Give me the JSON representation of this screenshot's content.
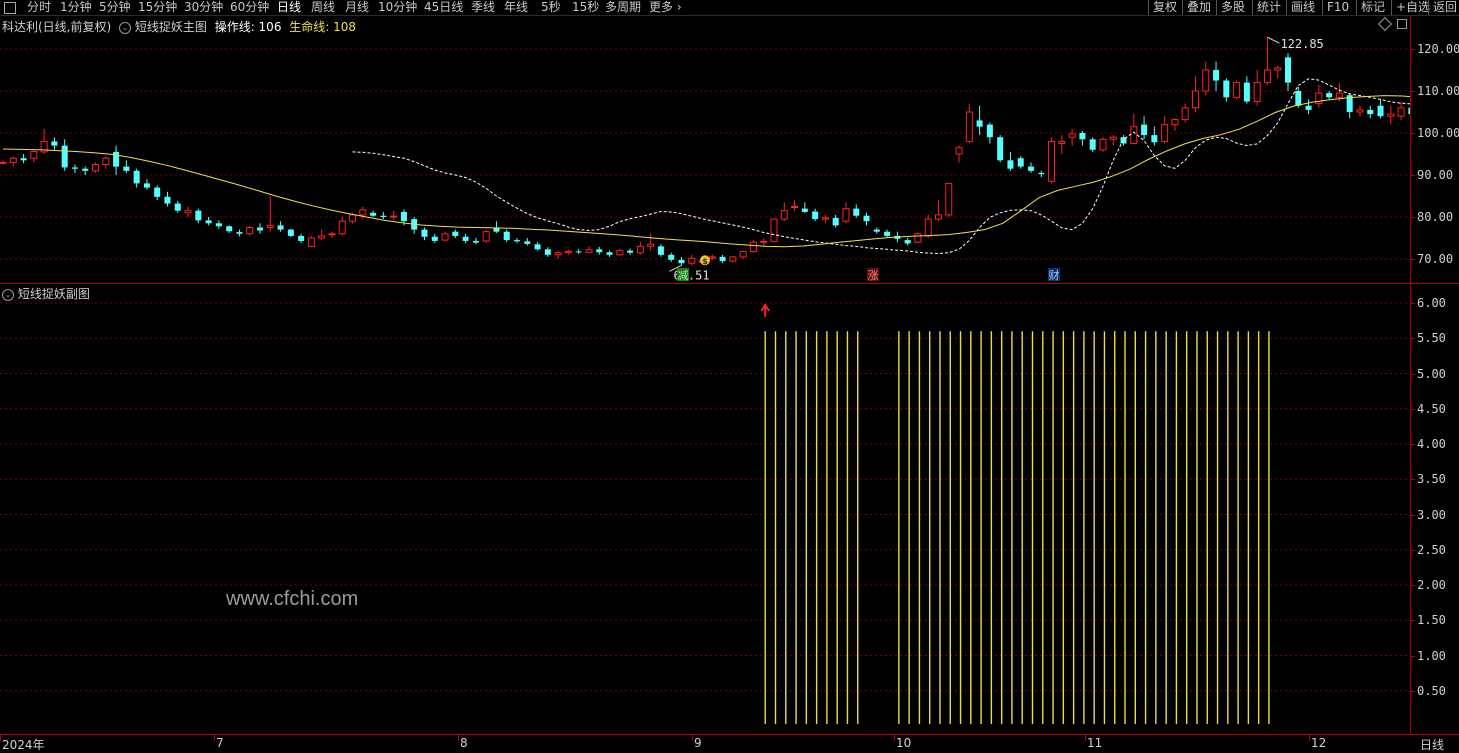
{
  "toolbar": {
    "periods": [
      "分时",
      "1分钟",
      "5分钟",
      "15分钟",
      "30分钟",
      "60分钟",
      "日线",
      "周线",
      "月线",
      "10分钟",
      "45日线",
      "季线",
      "年线",
      "5秒",
      "15秒",
      "多周期",
      "更多"
    ],
    "active_period": "日线",
    "right_buttons": [
      "复权",
      "叠加",
      "多股",
      "统计",
      "画线",
      "F10",
      "标记",
      "+自选",
      "返回"
    ]
  },
  "main": {
    "stock_title": "科达利(日线,前复权)",
    "indicator_name": "短线捉妖主图",
    "op_line_label": "操作线: 106",
    "life_line_label": "生命线: 108",
    "high_label": "122.85",
    "low_label": "68.51",
    "markers": [
      "减",
      "涨",
      "财"
    ],
    "buy_marker": "$"
  },
  "sub": {
    "indicator_name": "短线捉妖副图",
    "signal_value": 5.6
  },
  "y_axis_main": [
    "120.00",
    "110.00",
    "100.00",
    "90.00",
    "80.00",
    "70.00"
  ],
  "y_axis_sub": [
    "6.00",
    "5.50",
    "5.00",
    "4.50",
    "4.00",
    "3.50",
    "3.00",
    "2.50",
    "2.00",
    "1.50",
    "1.00",
    "0.50"
  ],
  "x_axis": [
    "2024年",
    "7",
    "8",
    "9",
    "10",
    "11",
    "12"
  ],
  "period_label": "日线",
  "watermark": "www.cfchi.com",
  "colors": {
    "up": "#ff2020",
    "down": "#54ffff",
    "ma_white": "#ffffff",
    "ma_yellow": "#f0e050",
    "signal": "#e8e040",
    "grid": "#8b0000",
    "axis": "#b00000"
  },
  "chart_data": {
    "type": "candlestick",
    "ylim": [
      66,
      124
    ],
    "candles": [
      [
        93,
        93.5,
        92.5,
        93
      ],
      [
        93,
        94.5,
        92,
        94
      ],
      [
        94,
        95,
        92.8,
        93.5
      ],
      [
        94,
        96,
        93,
        95.6
      ],
      [
        95.5,
        101,
        95,
        98
      ],
      [
        98,
        99,
        96,
        97
      ],
      [
        97,
        98.5,
        91,
        91.8
      ],
      [
        91.8,
        92.5,
        90.5,
        91.5
      ],
      [
        91.5,
        92,
        90,
        91
      ],
      [
        91,
        93,
        90.5,
        92.5
      ],
      [
        92.5,
        94.5,
        91.5,
        94
      ],
      [
        95.5,
        97,
        90,
        92
      ],
      [
        92,
        93.5,
        90.5,
        91
      ],
      [
        91,
        91.5,
        87,
        88
      ],
      [
        88,
        89,
        86.5,
        87
      ],
      [
        87,
        87.5,
        84,
        84.8
      ],
      [
        84.8,
        86,
        82.5,
        83.2
      ],
      [
        83.2,
        83.8,
        81,
        81.5
      ],
      [
        81,
        82.5,
        80,
        81.5
      ],
      [
        81.5,
        82,
        78.5,
        79.2
      ],
      [
        79.2,
        80,
        78,
        78.5
      ],
      [
        78.5,
        79.2,
        77.2,
        77.8
      ],
      [
        77.8,
        78,
        76.2,
        76.6
      ],
      [
        76.4,
        77,
        75.4,
        76
      ],
      [
        76,
        78,
        75.5,
        77.5
      ],
      [
        77.5,
        78.5,
        76,
        76.8
      ],
      [
        77.5,
        85,
        76.5,
        78
      ],
      [
        78,
        79,
        76.5,
        77
      ],
      [
        77,
        77.2,
        75.2,
        75.5
      ],
      [
        75.5,
        76,
        73.8,
        74.3
      ],
      [
        73,
        75.5,
        72.8,
        75
      ],
      [
        75,
        77,
        74.5,
        75.5
      ],
      [
        75.8,
        76.5,
        75,
        76
      ],
      [
        76,
        80,
        75.5,
        79
      ],
      [
        79,
        81,
        78.5,
        80.5
      ],
      [
        80.5,
        82.5,
        79.5,
        81.7
      ],
      [
        81,
        81.5,
        80,
        80.3
      ],
      [
        80.3,
        81.2,
        79.5,
        80
      ],
      [
        80,
        81.5,
        79.2,
        80.2
      ],
      [
        81.2,
        81.8,
        78,
        79
      ],
      [
        79.5,
        80,
        76,
        77
      ],
      [
        77,
        77.5,
        74.5,
        75.3
      ],
      [
        75.3,
        76,
        73.8,
        74.3
      ],
      [
        74.5,
        76.5,
        74.3,
        76
      ],
      [
        76.5,
        77,
        75,
        75.5
      ],
      [
        75.3,
        76,
        73.8,
        74.3
      ],
      [
        74.3,
        75,
        73.5,
        73.9
      ],
      [
        74.3,
        77,
        73.8,
        76.5
      ],
      [
        77.5,
        79,
        76.2,
        76.5
      ],
      [
        76.5,
        77,
        74,
        74.5
      ],
      [
        74.5,
        75,
        73.8,
        74.2
      ],
      [
        74.2,
        75,
        73.2,
        73.6
      ],
      [
        73.5,
        74,
        72,
        72.3
      ],
      [
        72.3,
        72.8,
        70.5,
        71
      ],
      [
        71,
        72,
        70,
        71.5
      ],
      [
        71.5,
        72.2,
        71,
        71.8
      ],
      [
        71.8,
        72.4,
        71.2,
        71.6
      ],
      [
        71.6,
        73,
        71.5,
        72.2
      ],
      [
        72.3,
        72.9,
        71,
        71.6
      ],
      [
        71.6,
        72,
        70.5,
        71
      ],
      [
        71,
        72.5,
        70.8,
        72
      ],
      [
        72,
        72.5,
        71,
        71.5
      ],
      [
        71.5,
        74,
        71,
        73
      ],
      [
        73,
        76,
        72,
        73.5
      ],
      [
        73,
        73.5,
        70.5,
        71
      ],
      [
        71,
        71.5,
        69.3,
        69.8
      ],
      [
        69.8,
        70.5,
        68.5,
        69
      ],
      [
        69,
        71,
        68.5,
        70.2
      ],
      [
        69.5,
        70,
        69,
        69.5
      ],
      [
        70.2,
        71,
        69.8,
        70.5
      ],
      [
        70.5,
        71,
        69,
        69.5
      ],
      [
        69.5,
        70.8,
        69.2,
        70.5
      ],
      [
        70.5,
        72,
        70,
        71.8
      ],
      [
        71.8,
        74.5,
        71.5,
        74
      ],
      [
        74,
        75,
        73.2,
        74.2
      ],
      [
        74.2,
        79,
        74,
        79.5
      ],
      [
        79.5,
        83.5,
        79,
        81.5
      ],
      [
        82.5,
        84,
        81.5,
        82.5
      ],
      [
        82,
        83.5,
        81,
        81.2
      ],
      [
        81.3,
        82,
        79,
        79.5
      ],
      [
        79.5,
        80.5,
        78.5,
        79.8
      ],
      [
        79.8,
        80.5,
        77.5,
        78
      ],
      [
        79,
        83.5,
        78.5,
        82
      ],
      [
        82,
        83,
        79.8,
        80.3
      ],
      [
        80.3,
        81,
        78,
        79
      ],
      [
        77,
        77.5,
        76,
        76.5
      ],
      [
        76.5,
        77,
        75,
        75.5
      ],
      [
        75.5,
        76.5,
        74,
        74.8
      ],
      [
        74.5,
        75,
        73.2,
        73.7
      ],
      [
        74,
        76.5,
        73.8,
        76
      ],
      [
        75.5,
        80.5,
        75,
        79.5
      ],
      [
        79.5,
        84,
        79,
        80.5
      ],
      [
        80.5,
        88,
        80,
        88
      ],
      [
        95,
        97,
        93,
        96.5
      ],
      [
        98,
        107,
        97.5,
        105
      ],
      [
        103,
        106.5,
        99.5,
        101.5
      ],
      [
        102,
        102.5,
        97.5,
        99
      ],
      [
        99,
        99.5,
        93,
        93.5
      ],
      [
        93.5,
        95.5,
        91,
        91.5
      ],
      [
        94,
        94.5,
        91.5,
        92
      ],
      [
        92,
        93,
        90.5,
        91
      ],
      [
        90.5,
        91,
        89.5,
        90.2
      ],
      [
        88.5,
        99,
        88,
        98
      ],
      [
        97.5,
        99.5,
        95,
        98
      ],
      [
        99,
        101,
        97,
        99.8
      ],
      [
        100,
        100.5,
        97,
        98.5
      ],
      [
        98.5,
        99,
        95.5,
        96
      ],
      [
        96,
        99,
        95.5,
        98.5
      ],
      [
        98.5,
        99.5,
        97,
        99
      ],
      [
        99,
        99.5,
        97,
        97.5
      ],
      [
        97.5,
        104.5,
        97.5,
        101.5
      ],
      [
        102,
        104,
        98.5,
        99.5
      ],
      [
        99.5,
        101.5,
        97,
        97.8
      ],
      [
        98,
        104,
        97.5,
        102
      ],
      [
        102,
        103.5,
        100.5,
        103.2
      ],
      [
        103.2,
        107,
        102.5,
        106
      ],
      [
        106,
        113.5,
        105,
        110
      ],
      [
        110,
        117,
        109,
        115
      ],
      [
        115,
        117,
        110,
        112.5
      ],
      [
        112.5,
        113,
        107.5,
        108.5
      ],
      [
        108.5,
        112.5,
        108,
        112
      ],
      [
        112,
        113.5,
        107,
        107.5
      ],
      [
        107.5,
        115,
        106.5,
        112
      ],
      [
        112,
        122.8,
        111.5,
        115
      ],
      [
        115,
        116,
        113,
        115.5
      ],
      [
        118,
        119,
        110,
        112
      ],
      [
        110,
        111,
        106,
        106.5
      ],
      [
        106.5,
        108,
        104.5,
        105.5
      ],
      [
        107,
        111.5,
        106,
        109.5
      ],
      [
        109.5,
        110,
        108,
        108.5
      ],
      [
        108.5,
        112,
        107.5,
        109.5
      ],
      [
        109,
        109.5,
        103.5,
        105
      ],
      [
        105,
        106.5,
        104,
        105.5
      ],
      [
        105.5,
        106.5,
        103.5,
        104.5
      ],
      [
        106.5,
        108,
        103.5,
        104
      ],
      [
        104,
        106.5,
        102,
        104.5
      ],
      [
        104,
        107.5,
        103,
        106
      ],
      [
        106,
        107,
        103,
        104.5
      ],
      [
        104.5,
        105,
        101,
        102.5
      ],
      [
        102.5,
        104,
        99.5,
        101
      ],
      [
        103,
        106.5,
        102,
        105.5
      ],
      [
        105.5,
        107,
        102,
        106.5
      ],
      [
        107,
        111,
        104,
        107.5
      ],
      [
        105,
        110.5,
        104.5,
        110.2
      ],
      [
        110.2,
        113.5,
        109.5,
        112
      ]
    ],
    "ma_white": [
      95.5,
      95.4,
      95.2,
      94.8,
      94.4,
      94,
      93.2,
      92.2,
      91.2,
      90.5,
      90,
      89.4,
      88.3,
      86.8,
      85,
      83.5,
      82.1,
      80.8,
      79.8,
      79.1,
      78.4,
      77.6,
      77,
      76.8,
      77,
      77.8,
      78.9,
      79.6,
      80.1,
      80.7,
      81.3,
      81.2,
      80.8,
      80.2,
      79.6,
      79.1,
      78.6,
      78.1,
      77.6,
      77,
      76.3,
      75.8,
      75.3,
      74.9,
      74.5,
      74.1,
      73.8,
      73.5,
      73.2,
      73,
      72.7,
      72.5,
      72.3,
      72.1,
      71.9,
      71.6,
      71.4,
      71.3,
      71.5,
      72.3,
      74.4,
      77.5,
      79.9,
      81,
      81.6,
      81.7,
      81.5,
      80.5,
      79,
      77.4,
      77,
      78.5,
      82,
      87.3,
      93.5,
      98.5,
      100.2,
      98.2,
      94.6,
      92.2,
      91.6,
      93.5,
      96.5,
      98.3,
      99,
      98.7,
      97.6,
      97,
      97.4,
      99.4,
      102.4,
      107,
      111.3,
      112.9,
      112.6,
      111.4,
      110.2,
      109.3,
      108.9,
      108.5,
      108,
      107.4,
      107.1,
      106.9,
      106.4,
      106.1,
      105.7,
      105.6,
      105.8,
      106.7,
      108.2
    ],
    "ma_yellow": [
      96.2,
      96.1,
      96,
      95.8,
      95.6,
      95.3,
      94.9,
      94.2,
      93.3,
      92.3,
      91.2,
      90,
      88.8,
      87.6,
      86.3,
      85,
      83.8,
      82.7,
      81.7,
      80.8,
      80,
      79.2,
      78.6,
      78.1,
      77.8,
      77.6,
      77.5,
      77.4,
      77.3,
      77.1,
      76.9,
      76.6,
      76.3,
      76,
      75.7,
      75.3,
      74.9,
      74.6,
      74.3,
      74,
      73.6,
      73.3,
      73,
      72.9,
      73.1,
      73.5,
      74,
      74.4,
      74.8,
      75.2,
      75.4,
      75.6,
      75.8,
      76.3,
      77,
      78.5,
      81.5,
      84.6,
      86.3,
      87.3,
      88.3,
      89.7,
      91.4,
      93.7,
      95.7,
      97.4,
      98.7,
      99.6,
      100.9,
      102.8,
      104.9,
      106.4,
      107.3,
      107.9,
      108.4,
      108.7,
      108.9,
      108.8,
      108.4,
      108.1,
      107.9,
      107.9
    ],
    "signal_bars_day_indices": [
      74,
      75,
      76,
      77,
      78,
      79,
      80,
      81,
      82,
      83,
      87,
      88,
      89,
      90,
      91,
      92,
      93,
      94,
      95,
      96,
      97,
      98,
      99,
      100,
      101,
      102,
      103,
      104,
      105,
      106,
      107,
      108,
      109,
      110,
      111,
      112,
      113,
      114,
      115,
      116,
      117,
      118,
      119,
      120,
      121,
      122,
      123
    ],
    "signal_level": 5.6,
    "sub_ylim": [
      0,
      6.35
    ]
  }
}
